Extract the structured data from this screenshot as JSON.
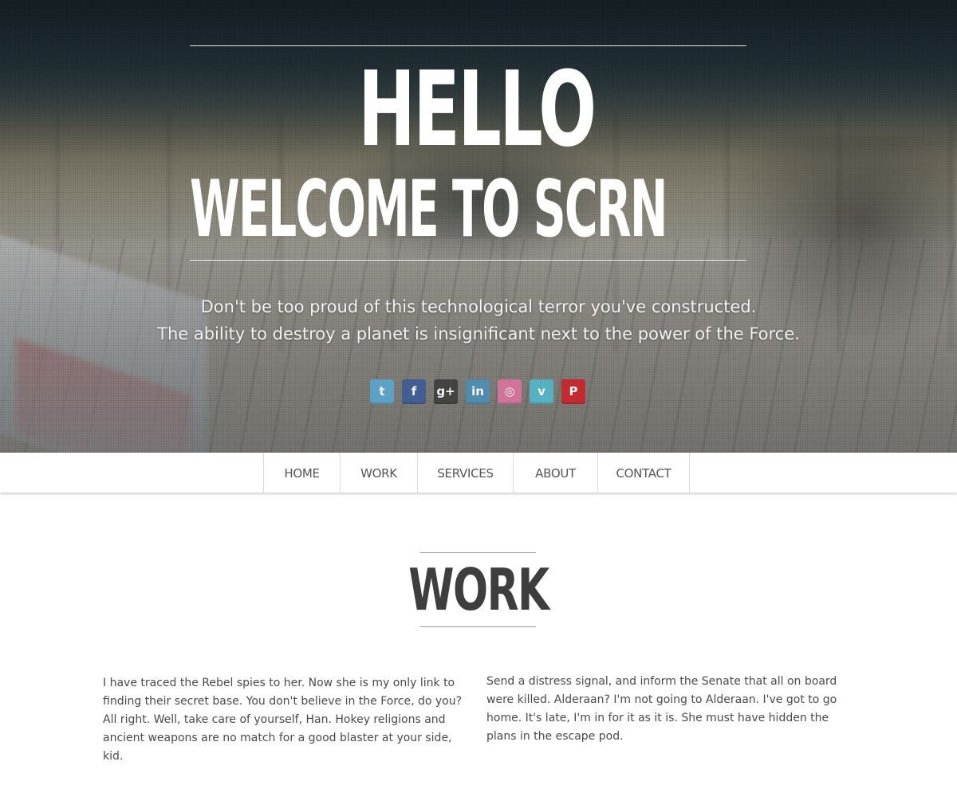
{
  "hero": {
    "hello": "HELLO",
    "welcome": "WELCOME TO SCRN",
    "tagline_1": "Don't be too proud of this technological terror you've constructed.",
    "tagline_2": "The ability to destroy a planet is insignificant next to the power of the Force."
  },
  "social": [
    {
      "name": "twitter-icon",
      "glyph": "t",
      "color": "#5aa6cc"
    },
    {
      "name": "facebook-icon",
      "glyph": "f",
      "color": "#3f5c93"
    },
    {
      "name": "google-plus-icon",
      "glyph": "g+",
      "color": "#3f3f3f"
    },
    {
      "name": "linkedin-icon",
      "glyph": "in",
      "color": "#4d8fb2"
    },
    {
      "name": "dribbble-icon",
      "glyph": "◎",
      "color": "#d8739e"
    },
    {
      "name": "vimeo-icon",
      "glyph": "v",
      "color": "#55b5c8"
    },
    {
      "name": "pinterest-icon",
      "glyph": "P",
      "color": "#c8252a"
    }
  ],
  "nav": {
    "items": [
      "HOME",
      "WORK",
      "SERVICES",
      "ABOUT",
      "CONTACT"
    ]
  },
  "work": {
    "title": "WORK",
    "left_text": "I have traced the Rebel spies to her. Now she is my only link to finding their secret base. You don't believe in the Force, do you? All right. Well, take care of yourself, Han. Hokey religions and ancient weapons are no match for a good blaster at your side, kid.",
    "right_text": "Send a distress signal, and inform the Senate that all on board were killed. Alderaan? I'm not going to Alderaan. I've got to go home. It's late, I'm in for it as it is. She must have hidden the plans in the escape pod."
  }
}
